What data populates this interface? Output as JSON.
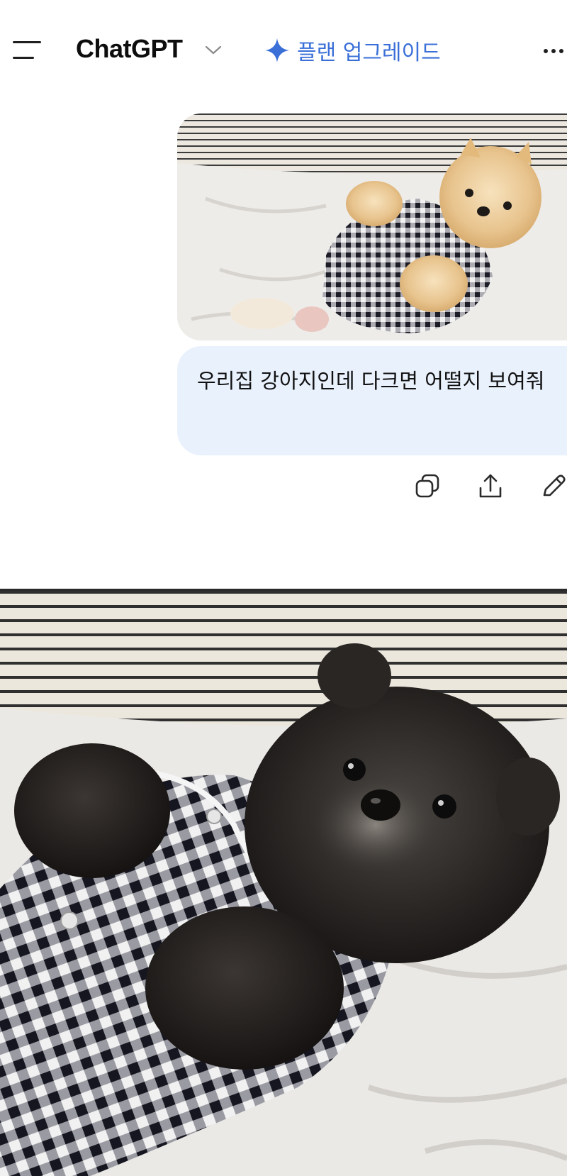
{
  "header": {
    "app_title": "ChatGPT",
    "upgrade_label": "플랜 업그레이드",
    "icons": [
      "hamburger-menu-icon",
      "chevron-down-icon",
      "sparkle-star-icon",
      "more-options-icon"
    ]
  },
  "conversation": {
    "user_message": {
      "image_subject": "dog-photo",
      "text": "우리집 강아지인데 다크면 어떨지 보여줘",
      "actions": [
        "copy-icon",
        "share-icon",
        "edit-icon"
      ]
    },
    "assistant_message": {
      "image_subject": "generated-dark-dog-image"
    }
  },
  "colors": {
    "accent": "#3a6fd8",
    "user_bubble_bg": "#e9f1fd",
    "text": "#0d0d0d",
    "background": "#ffffff"
  }
}
